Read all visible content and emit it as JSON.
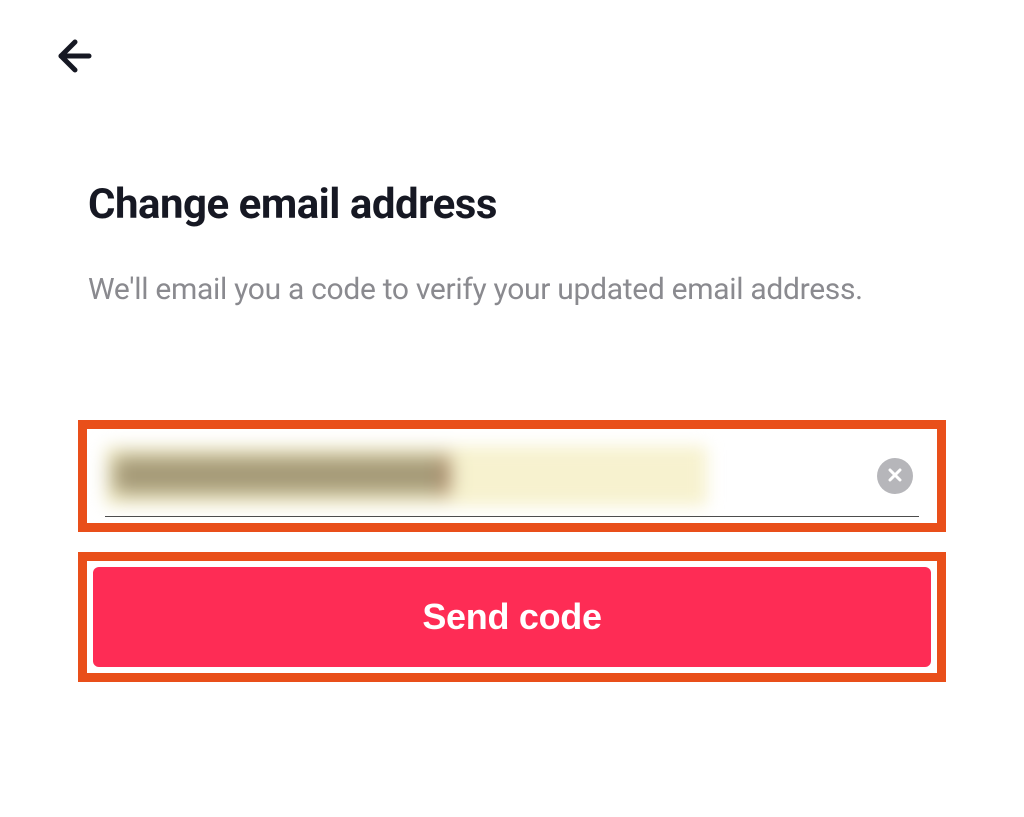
{
  "page": {
    "title": "Change email address",
    "subtitle": "We'll email you a code to verify your updated email address."
  },
  "input": {
    "value": ""
  },
  "button": {
    "sendLabel": "Send code"
  }
}
